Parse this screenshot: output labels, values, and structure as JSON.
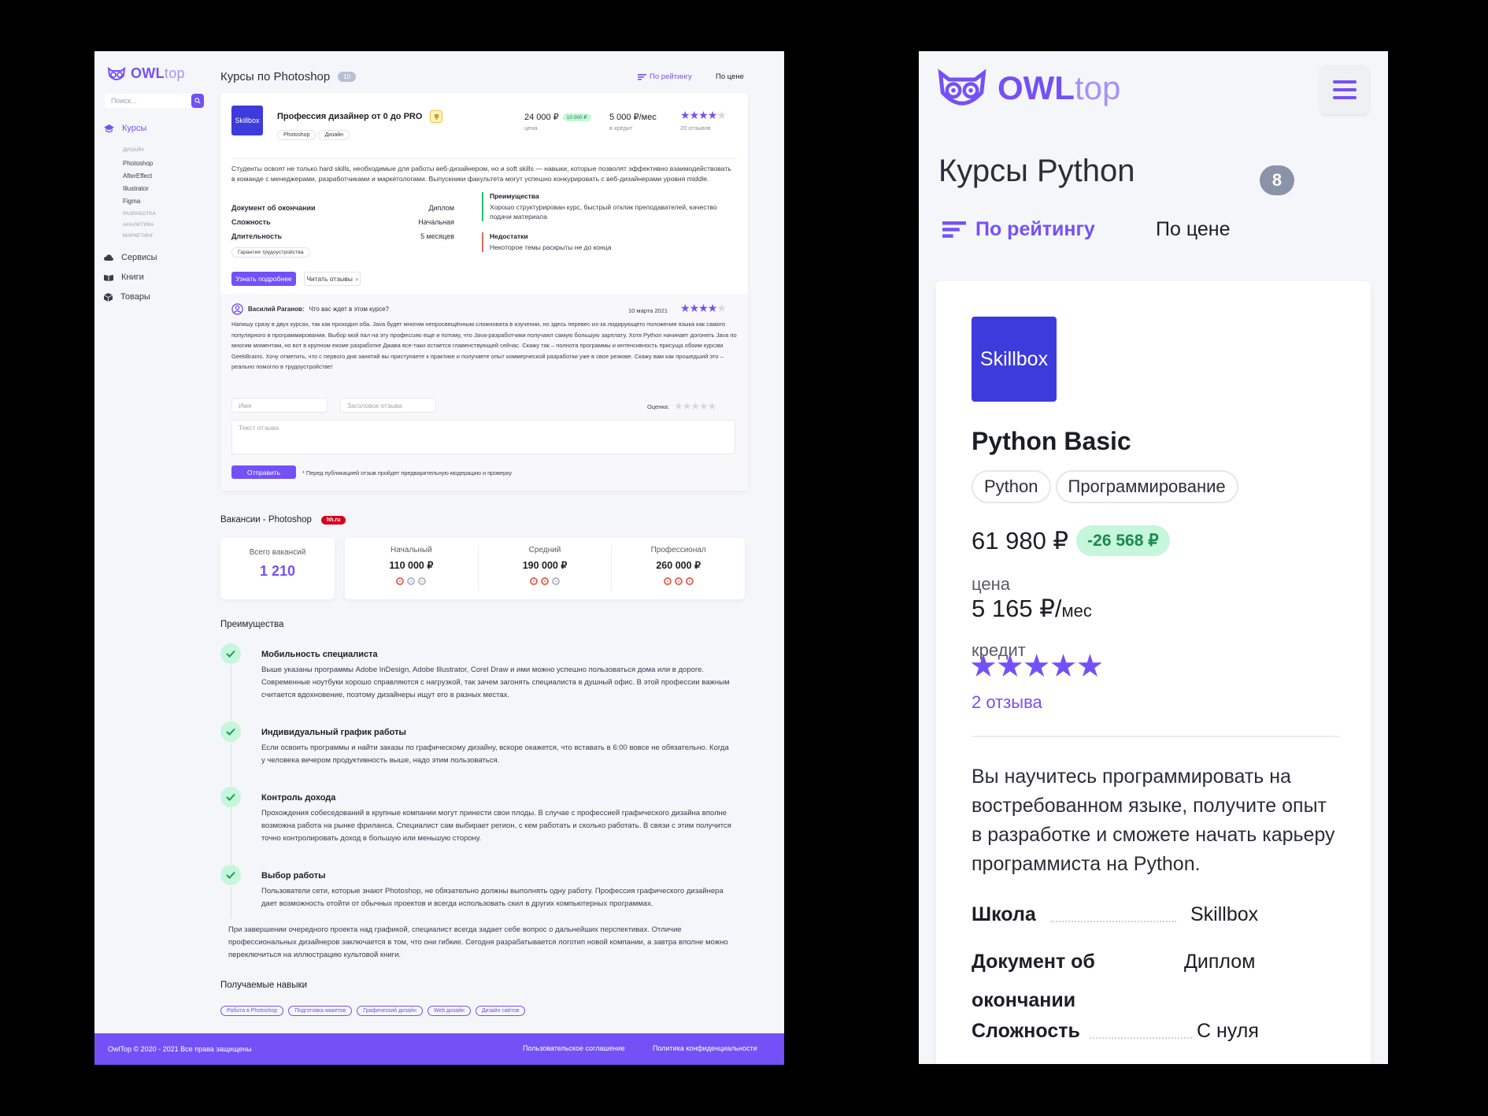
{
  "desktop": {
    "logo": {
      "brand": "OWL",
      "suffix": "top"
    },
    "search": {
      "placeholder": "Поиск..."
    },
    "sidebar": {
      "courses": "Курсы",
      "sub": [
        "ДИЗАЙН",
        "Photoshop",
        "AfterEffect",
        "Illustrator",
        "Figma",
        "РАЗРАБОТКА",
        "АНАЛИТИКА",
        "МАРКЕТИНГ"
      ],
      "services": "Сервисы",
      "books": "Книги",
      "goods": "Товары"
    },
    "header": {
      "title": "Курсы по Photoshop",
      "count": "10",
      "sort_rating": "По рейтингу",
      "sort_price": "По цене"
    },
    "course": {
      "logo_text": "Skillbox",
      "title": "Профессия дизайнер от 0 до PRO",
      "tags": [
        "Photoshop",
        "Дизайн"
      ],
      "price": "24 000 ₽",
      "discount": "10 000 ₽",
      "price_label": "цена",
      "credit": "5 000 ₽/мес",
      "credit_label": "в кредит",
      "rating": 4,
      "reviews": "20 отзывов",
      "description": "Студенты освоят не только hard skills, необходимые для работы веб-дизайнером, но и soft skills — навыки, которые позволят эффективно взаимодействовать в команде с менеджерами, разработчиками и маркетологами. Выпускники факультета могут успешно конкурировать с веб-дизайнерами уровня middle.",
      "facts": [
        {
          "k": "Документ об окончании",
          "v": "Диплом"
        },
        {
          "k": "Сложность",
          "v": "Начальная"
        },
        {
          "k": "Длительность",
          "v": "5 месяцев"
        }
      ],
      "guarantee": "Гарантия трудоустройства",
      "pros_title": "Преимущества",
      "pros_text": "Хорошо структурирован курс, быстрый отклик преподавателей, качество подачи материала",
      "cons_title": "Недостатки",
      "cons_text": "Некоторое темы раскрыты не до конца",
      "btn_more": "Узнать подробнее",
      "btn_reviews": "Читать отзывы"
    },
    "review": {
      "author": "Василий Раганов:",
      "question": "Что вас ждет в этом курсе?",
      "date": "10 марта 2021",
      "rating": 4,
      "text": "Напишу сразу в двух курсах, так как проходил оба. Java будет многим непросвещённым сложновата в изучении, но здесь перевес из-за лидирующего положения языка как самого популярного в программировании. Выбор мой пал на эту профессию еще и потому, что Java-разработчики получают самую большую зарплату. Хотя Python начинает догонять Java по многим моментам, но вот в крупном екоме разработке Джава все-таки остается главенствующей сейчас. Скажу так – полнота программы и интенсивность присуща обоим курсам GeekBrains. Хочу отметить, что с первого дня занятий вы приступаете к практике и получаете опыт коммерческой разработки уже в свое резюме. Скажу вам как прошедший это – реально помогло в трудоустройстве!",
      "name_placeholder": "Имя",
      "subject_placeholder": "Заголовок отзыва",
      "score_label": "Оценка:",
      "text_placeholder": "Текст отзыва",
      "submit": "Отправить",
      "note": "* Перед публикацией отзыв пройдет предварительную модерацию и проверку"
    },
    "vacancies": {
      "title": "Вакансии - Photoshop",
      "badge": "hh.ru",
      "total_label": "Всего вакансий",
      "total": "1 210",
      "levels": [
        {
          "label": "Начальный",
          "value": "110 000 ₽",
          "level": 1
        },
        {
          "label": "Средний",
          "value": "190 000 ₽",
          "level": 2
        },
        {
          "label": "Профессионал",
          "value": "260 000 ₽",
          "level": 3
        }
      ]
    },
    "advantages": {
      "title": "Преимущества",
      "items": [
        {
          "title": "Мобильность специалиста",
          "text": "Выше указаны программы Adobe InDesign, Adobe Illustrator, Corel Draw и ими можно успешно пользоваться дома или в дороге. Современные ноутбуки хорошо справляются с нагрузкой, так зачем загонять специалиста в душный офис. В этой профессии важным считается вдохновение, поэтому дизайнеры ищут его в разных местах."
        },
        {
          "title": "Индивидуальный график работы",
          "text": "Если освоить программы и найти заказы по графическому дизайну, вскоре окажется, что вставать в 6:00 вовсе не обязательно. Когда у человека вечером продуктивность выше, надо этим пользоваться."
        },
        {
          "title": "Контроль дохода",
          "text": "Прохождения собеседований в крупные компании могут принести свои плоды. В случае с профессией графического дизайна вполне возможна работа на рынке фриланса. Специалист сам выбирает регион, с кем работать и сколько работать. В связи с этим получится точно контролировать доход в большую или меньшую сторону."
        },
        {
          "title": "Выбор работы",
          "text": "Пользователи сети, которые знают Photoshop, не обязательно должны выполнять одну работу. Профессия графического дизайнера дает возможность отойти от обычных проектов и всегда использовать скил в других компьютерных программах."
        }
      ],
      "closing": "При завершении очередного проекта над графикой, специалист всегда задает себе вопрос о дальнейших перспективах. Отличие профессиональных дизайнеров заключается в том, что они гибкие. Сегодня разрабатывается логотип новой компании, а завтра вполне можно переключиться на иллюстрацию культовой книги."
    },
    "skills": {
      "title": "Получаемые навыки",
      "items": [
        "Работа в Photoshop",
        "Подготовка макетов",
        "Графический дизайн",
        "Web дизайн",
        "Дизайн сайтов"
      ]
    },
    "footer": {
      "copyright": "OwlTop © 2020 - 2021 Все права защищены",
      "terms": "Пользовательское соглашение",
      "privacy": "Политика конфиденциальности"
    }
  },
  "mobile": {
    "logo": {
      "brand": "OWL",
      "suffix": "top"
    },
    "title": "Курсы Python",
    "count": "8",
    "sort_rating": "По рейтингу",
    "sort_price": "По цене",
    "course": {
      "logo_text": "Skillbox",
      "title": "Python Basic",
      "tags": [
        "Python",
        "Программирование"
      ],
      "price": "61 980 ₽",
      "discount": "-26 568 ₽",
      "price_label": "цена",
      "credit": "5 165 ₽/",
      "credit_unit": "мес",
      "credit_label": "кредит",
      "rating": 5,
      "reviews": "2 отзыва",
      "description": "Вы научитесь программировать на востребованном языке, получите опыт в разработке и сможете начать карьеру программиста на Python.",
      "school_label": "Школа",
      "school": "Skillbox",
      "doc_label_1": "Документ об",
      "doc_label_2": "окончании",
      "doc": "Диплом",
      "level_label": "Сложность",
      "level": "С нуля"
    }
  },
  "colors": {
    "accent": "#7351f7",
    "success": "#1b8a4d",
    "hh": "#d6001c",
    "background": "#f5f6fa"
  }
}
